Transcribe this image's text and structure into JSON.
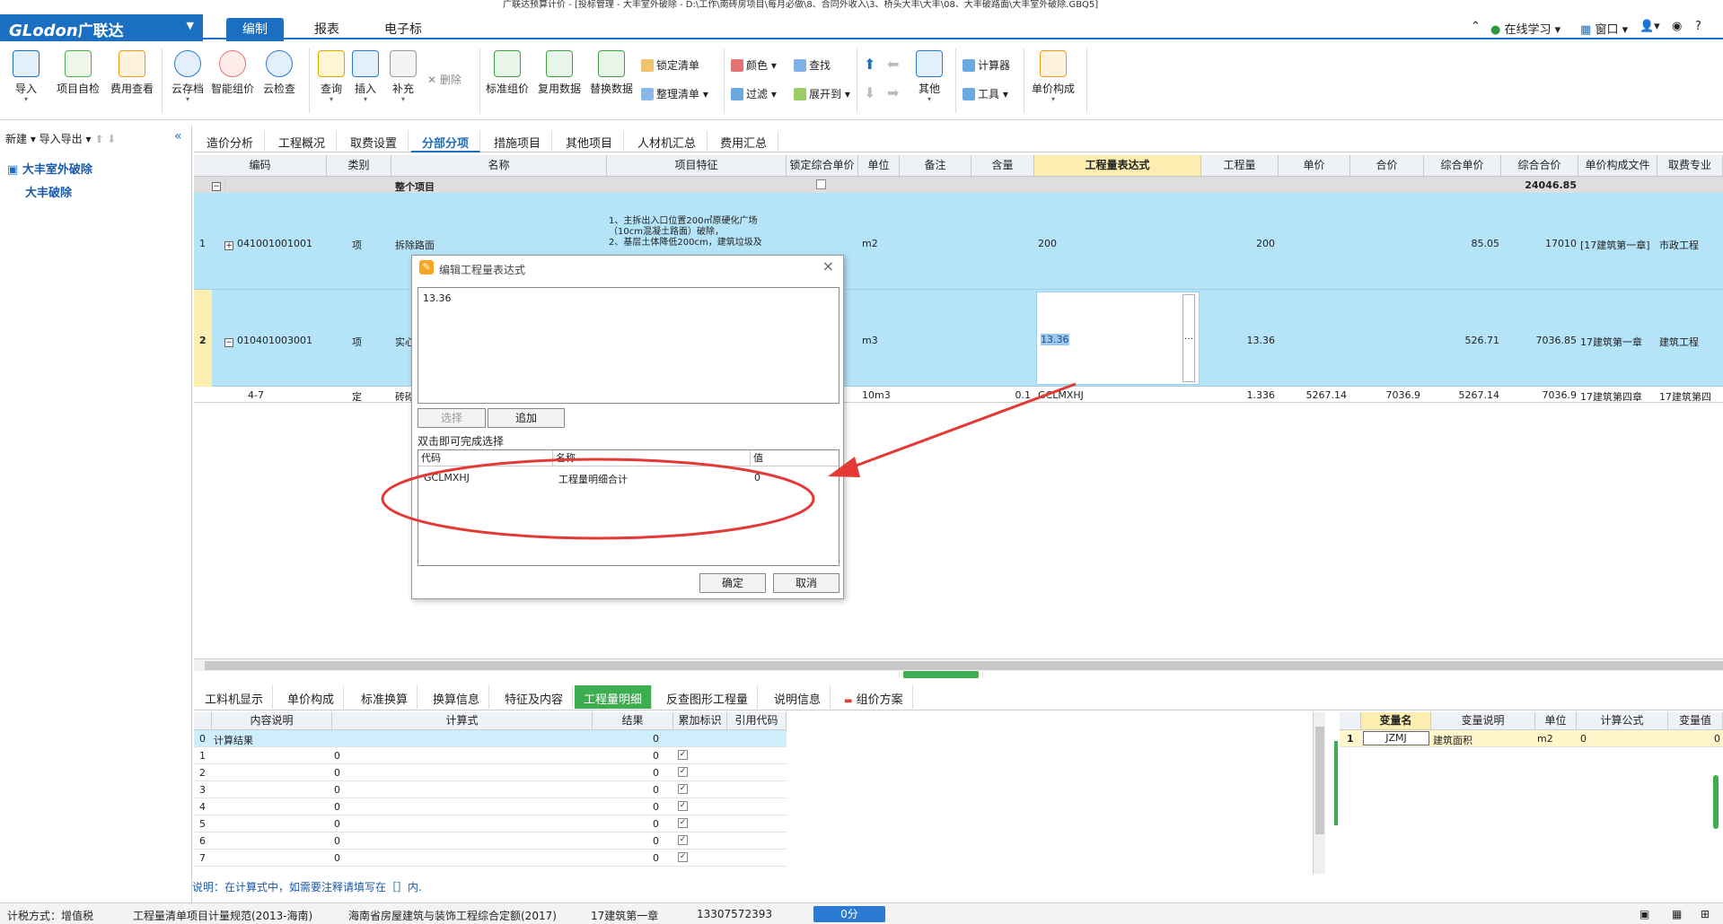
{
  "window": {
    "title": "广联达预算计价 - [投标管理 - 大丰室外破除 - D:\\工作\\南砖房项目\\每月必做\\8、合同外收入\\3、桥头大丰\\大丰\\08、大丰破路面\\大丰室外破除.GBQ5]"
  },
  "menu": {
    "logo": "GLodon",
    "logo_cn": "广联达",
    "tabs": [
      "编制",
      "报表",
      "电子标"
    ],
    "right": {
      "online": "在线学习",
      "window": "窗口",
      "help": "?"
    }
  },
  "ribbon": {
    "big_buttons": [
      "导入",
      "项目自检",
      "费用查看",
      "云存档",
      "智能组价",
      "云检查",
      "查询",
      "插入",
      "补充",
      "标准组价",
      "复用数据",
      "替换数据",
      "其他",
      "单价构成"
    ],
    "delete": "删除",
    "lock_list": "锁定清单",
    "tidy_list": "整理清单",
    "color": "颜色",
    "find": "查找",
    "filter": "过滤",
    "expand": "展开到",
    "calculator": "计算器",
    "tools": "工具"
  },
  "left": {
    "new": "新建",
    "import_export": "导入导出",
    "project": "大丰室外破除",
    "unit": "大丰破除"
  },
  "tabs": [
    "造价分析",
    "工程概况",
    "取费设置",
    "分部分项",
    "措施项目",
    "其他项目",
    "人材机汇总",
    "费用汇总"
  ],
  "grid": {
    "headers": [
      "编码",
      "类别",
      "名称",
      "项目特征",
      "锁定综合单价",
      "单位",
      "备注",
      "含量",
      "工程量表达式",
      "工程量",
      "单价",
      "合价",
      "综合单价",
      "综合合价",
      "单价构成文件",
      "取费专业"
    ],
    "total_row": {
      "name": "整个项目",
      "total": "24046.85"
    },
    "rows": [
      {
        "num": "1",
        "code": "041001001001",
        "type": "项",
        "name": "拆除路面",
        "feature1": "1、主拆出入口位置200㎡原硬化广场",
        "feature2": "（10cm混凝土路面）破除，",
        "feature3": "2、基层土体降低200cm，建筑垃圾及",
        "unit": "m2",
        "expr": "200",
        "qty": "200",
        "unitprice": "",
        "total": "",
        "comp_price": "85.05",
        "comp_total": "17010",
        "file": "[17建筑第一章]",
        "major": "市政工程"
      },
      {
        "num": "2",
        "code": "010401003001",
        "type": "项",
        "name": "实心",
        "unit": "m3",
        "expr": "13.36",
        "qty": "13.36",
        "comp_price": "526.71",
        "comp_total": "7036.85",
        "file": "17建筑第一章",
        "major": "建筑工程"
      },
      {
        "num": "",
        "code": "4-7",
        "type": "定",
        "name": "砖砌",
        "unit": "10m3",
        "content": "0.1",
        "expr": "GCLMXHJ",
        "qty": "1.336",
        "unitprice": "5267.14",
        "total": "7036.9",
        "comp_price": "5267.14",
        "comp_total": "7036.9",
        "file": "17建筑第四章",
        "major": "17建筑第四"
      }
    ]
  },
  "dialog": {
    "title": "编辑工程量表达式",
    "value": "13.36",
    "select": "选择",
    "append": "追加",
    "hint": "双击即可完成选择",
    "col_code": "代码",
    "col_name": "名称",
    "col_value": "值",
    "item_code": "GCLMXHJ",
    "item_name": "工程量明细合计",
    "item_value": "0",
    "ok": "确定",
    "cancel": "取消"
  },
  "bottom_tabs": [
    "工料机显示",
    "单价构成",
    "标准换算",
    "换算信息",
    "特征及内容",
    "工程量明细",
    "反查图形工程量",
    "说明信息",
    "组价方案"
  ],
  "detail": {
    "headers": [
      "内容说明",
      "计算式",
      "结果",
      "累加标识",
      "引用代码"
    ],
    "calc_row": {
      "num": "0",
      "desc": "计算结果",
      "result": "0"
    },
    "rows": [
      {
        "num": "1",
        "expr": "0",
        "result": "0"
      },
      {
        "num": "2",
        "expr": "0",
        "result": "0"
      },
      {
        "num": "3",
        "expr": "0",
        "result": "0"
      },
      {
        "num": "4",
        "expr": "0",
        "result": "0"
      },
      {
        "num": "5",
        "expr": "0",
        "result": "0"
      },
      {
        "num": "6",
        "expr": "0",
        "result": "0"
      },
      {
        "num": "7",
        "expr": "0",
        "result": "0"
      }
    ],
    "hint": "说明：在计算式中，如需要注释请填写在［］内."
  },
  "vars": {
    "headers": [
      "变量名",
      "变量说明",
      "单位",
      "计算公式",
      "变量值"
    ],
    "row": {
      "num": "1",
      "name": "JZMJ",
      "desc": "建筑面积",
      "unit": "m2",
      "formula": "0",
      "value": "0"
    }
  },
  "status": {
    "tax": "计税方式：增值税",
    "spec": "工程量清单项目计量规范(2013-海南)",
    "quota": "海南省房屋建筑与装饰工程综合定额(2017)",
    "chapter": "17建筑第一章",
    "phone": "13307572393",
    "score": "0分"
  },
  "colors": {
    "brand": "#1a6fc2",
    "selected_row": "#b5e3f7",
    "active_bottom_tab": "#3dae4f",
    "annotation": "#e53935"
  }
}
